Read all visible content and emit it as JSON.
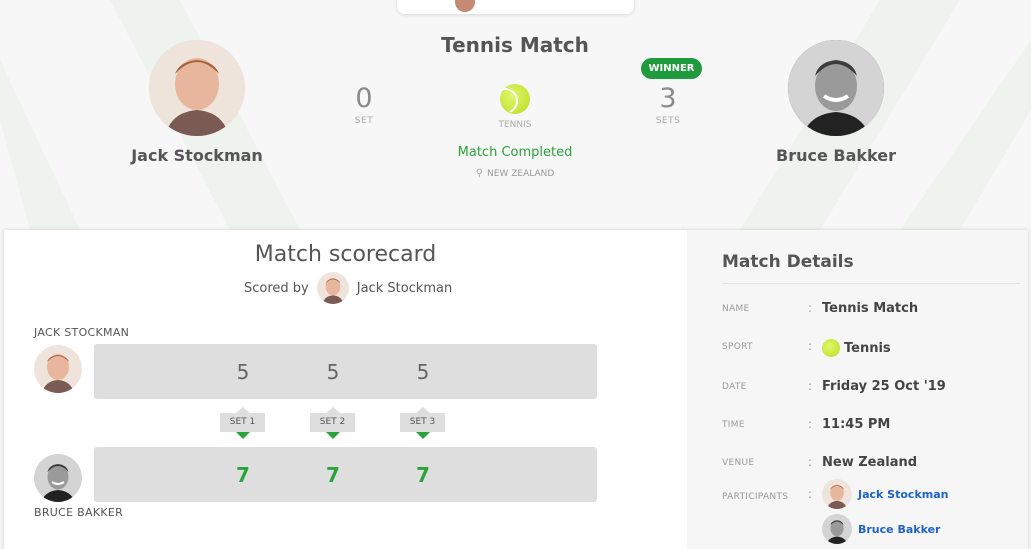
{
  "header": {
    "title": "Tennis Match",
    "player1": {
      "name": "Jack Stockman",
      "sets": "0",
      "sets_label": "SET"
    },
    "player2": {
      "name": "Bruce Bakker",
      "sets": "3",
      "sets_label": "SETS",
      "badge": "WINNER"
    },
    "sport_label": "TENNIS",
    "status": "Match Completed",
    "location": "NEW ZEALAND"
  },
  "scorecard": {
    "title": "Match scorecard",
    "scored_by_label": "Scored by",
    "scored_by_name": "Jack Stockman",
    "row1_label": "JACK STOCKMAN",
    "row2_label": "BRUCE BAKKER",
    "row1_scores": [
      "5",
      "5",
      "5"
    ],
    "row2_scores": [
      "7",
      "7",
      "7"
    ],
    "sets": [
      "SET 1",
      "SET 2",
      "SET 3"
    ]
  },
  "details": {
    "title": "Match Details",
    "rows": [
      {
        "key": "NAME",
        "value": "Tennis Match"
      },
      {
        "key": "SPORT",
        "value": "Tennis"
      },
      {
        "key": "DATE",
        "value": "Friday 25 Oct '19"
      },
      {
        "key": "TIME",
        "value": "11:45 PM"
      },
      {
        "key": "VENUE",
        "value": "New Zealand"
      },
      {
        "key": "PARTICIPANTS",
        "value": ""
      }
    ],
    "participants": [
      "Jack Stockman",
      "Bruce Bakker"
    ]
  },
  "colors": {
    "accent_green": "#2aa33d",
    "winner_badge": "#1f9a3c",
    "link_blue": "#1e63c6",
    "bar_grey": "#dedede"
  },
  "icons": [
    "tennis-ball-icon",
    "location-pin-icon"
  ]
}
